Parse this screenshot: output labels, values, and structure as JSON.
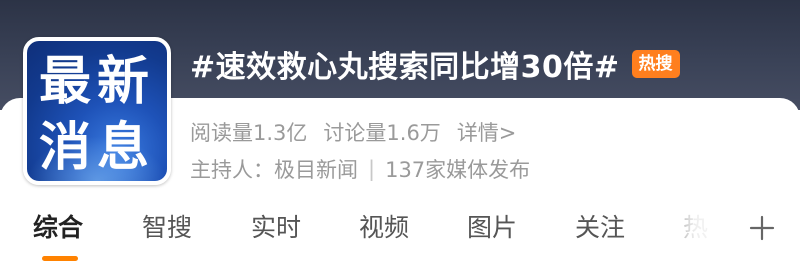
{
  "header": {
    "logo": {
      "line1": "最新",
      "line2": "消息"
    },
    "title": "#速效救心丸搜索同比增30倍#",
    "badge": "热搜",
    "colors": {
      "badge": "#ff7f1e",
      "header_bg": "#3a4257"
    }
  },
  "stats": {
    "reads": "阅读量1.3亿",
    "discussions": "讨论量1.6万",
    "details_link": "详情>"
  },
  "host": {
    "label": "主持人：极目新闻",
    "separator": "|",
    "media": "137家媒体发布"
  },
  "tabs": {
    "items": [
      "综合",
      "智搜",
      "实时",
      "视频",
      "图片",
      "关注",
      "热"
    ],
    "active": "综合",
    "accent": "#ff8200",
    "more_icon": "plus-icon"
  }
}
